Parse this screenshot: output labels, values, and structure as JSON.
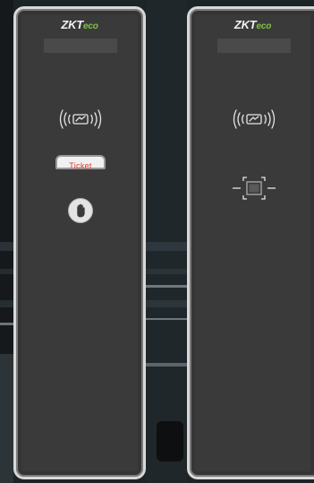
{
  "terminals": [
    {
      "brand_main": "ZKT",
      "brand_suffix": "eco",
      "rfid_icon": "rfid-card-reader-icon",
      "ticket_label": "Ticket",
      "push_button_icon": "hand-stop-icon"
    },
    {
      "brand_main": "ZKT",
      "brand_suffix": "eco",
      "rfid_icon": "rfid-card-reader-icon",
      "scanner_icon": "qr-code-scanner-icon"
    }
  ],
  "colors": {
    "terminal_body": "#3a3a3b",
    "terminal_frame": "#d8d8d8",
    "brand_green": "#7fc241",
    "ticket_text": "#d63a2e"
  }
}
